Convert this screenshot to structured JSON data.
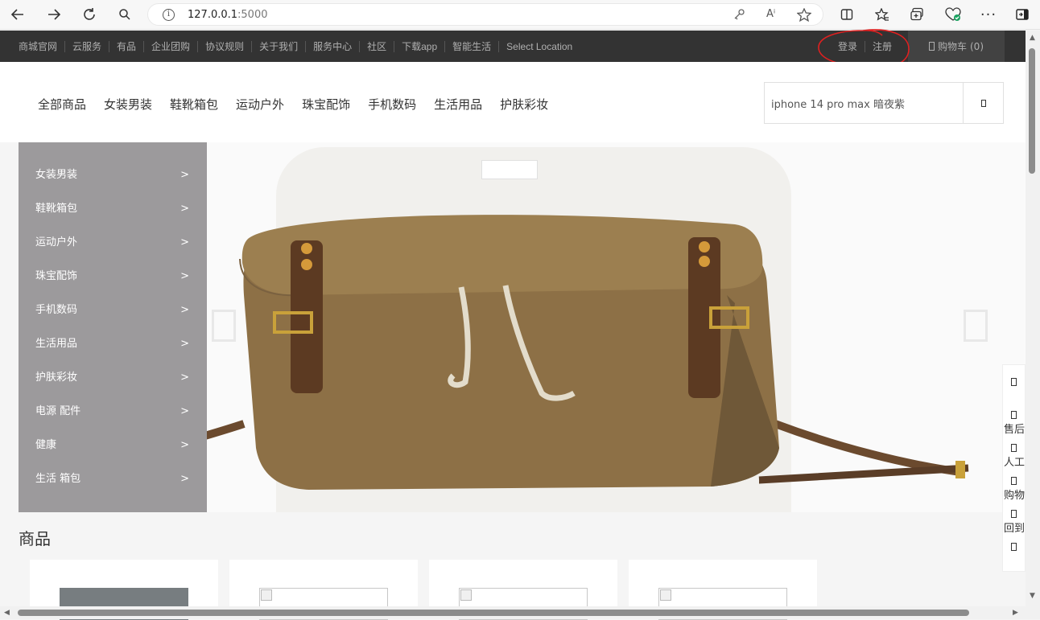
{
  "browser": {
    "address_host": "127.0.0.1",
    "address_port": ":5000",
    "icons": [
      "back-icon",
      "forward-icon",
      "refresh-icon",
      "search-icon",
      "info-icon",
      "key-icon",
      "read-aloud-icon",
      "favorite-icon",
      "split-screen-icon",
      "favorites-icon",
      "collections-icon",
      "health-icon",
      "more-icon",
      "sidebar-icon"
    ],
    "read_aloud_label": "Aⁱ"
  },
  "topbar": {
    "links": [
      "商城官网",
      "云服务",
      "有品",
      "企业团购",
      "协议规则",
      "关于我们",
      "服务中心",
      "社区",
      "下载app",
      "智能生活",
      "Select Location"
    ],
    "login": "登录",
    "register": "注册",
    "cart": "购物车",
    "cart_count": "(0)",
    "annotation_color": "#e02020"
  },
  "header": {
    "categories": [
      "全部商品",
      "女装男装",
      "鞋靴箱包",
      "运动户外",
      "珠宝配饰",
      "手机数码",
      "生活用品",
      "护肤彩妆"
    ],
    "search_value": "iphone 14 pro max 暗夜紫"
  },
  "sidebar": {
    "items": [
      {
        "label": "女装男装",
        "arrow": ">"
      },
      {
        "label": "鞋靴箱包",
        "arrow": ">"
      },
      {
        "label": "运动户外",
        "arrow": ">"
      },
      {
        "label": "珠宝配饰",
        "arrow": ">"
      },
      {
        "label": "手机数码",
        "arrow": ">"
      },
      {
        "label": "生活用品",
        "arrow": ">"
      },
      {
        "label": "护肤彩妆",
        "arrow": ">"
      },
      {
        "label": "电源 配件",
        "arrow": ">"
      },
      {
        "label": "健康",
        "arrow": ">"
      },
      {
        "label": "生活 箱包",
        "arrow": ">"
      }
    ]
  },
  "floating_tools": [
    {
      "icon": "phone-icon",
      "label": ""
    },
    {
      "icon": "service-icon",
      "label": "售后"
    },
    {
      "icon": "chat-icon",
      "label": "人工"
    },
    {
      "icon": "cart-icon",
      "label": "购物"
    },
    {
      "icon": "back-top-icon",
      "label": "回到"
    },
    {
      "icon": "arrow-up-icon",
      "label": ""
    }
  ],
  "products": {
    "title": "商品",
    "cards": 4
  }
}
